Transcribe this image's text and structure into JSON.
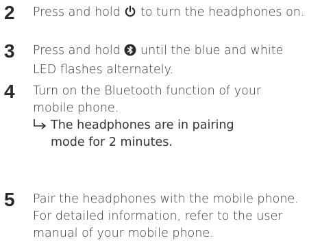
{
  "steps": [
    {
      "number": "2",
      "before": "Press and hold",
      "icon": "power-icon",
      "after": "to turn the headphones on."
    },
    {
      "number": "3",
      "before": "Press and hold",
      "icon": "bluetooth-button-icon",
      "after": "until the blue and white LED flashes alternately."
    },
    {
      "number": "4",
      "text": "Turn on the Bluetooth function of your mobile phone.",
      "result": {
        "icon": "result-arrow-icon",
        "text": "The headphones are in pairing mode for 2 minutes."
      }
    },
    {
      "number": "5",
      "text": "Pair the headphones with the mobile phone. For detailed information, refer to the user manual of your mobile phone."
    }
  ],
  "colors": {
    "text": "#333333",
    "number": "#2a2a2a"
  }
}
